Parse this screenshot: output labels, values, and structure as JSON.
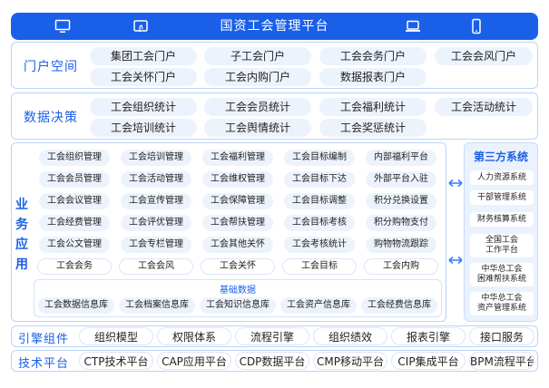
{
  "header": {
    "title": "国资工会管理平台",
    "accent": "#1a5fe8",
    "icons": [
      "desktop-icon",
      "tablet-touch-icon",
      "laptop-icon",
      "mobile-icon"
    ]
  },
  "portal": {
    "label": "门户空间",
    "items": [
      "集团工会门户",
      "子工会门户",
      "工会会务门户",
      "工会会风门户",
      "工会关怀门户",
      "工会内购门户",
      "数据报表门户"
    ]
  },
  "decision": {
    "label": "数据决策",
    "items": [
      "工会组织统计",
      "工会会员统计",
      "工会福利统计",
      "工会活动统计",
      "工会培训统计",
      "工会舆情统计",
      "工会奖惩统计"
    ]
  },
  "business": {
    "label_chars": [
      "业",
      "务",
      "应",
      "用"
    ],
    "grid": [
      [
        "工会组织管理",
        "工会培训管理",
        "工会福利管理",
        "工会目标编制",
        "内部福利平台"
      ],
      [
        "工会会员管理",
        "工会活动管理",
        "工会维权管理",
        "工会目标下达",
        "外部平台入驻"
      ],
      [
        "工会会议管理",
        "工会宣传管理",
        "工会保障管理",
        "工会目标调整",
        "积分兑换设置"
      ],
      [
        "工会经费管理",
        "工会评优管理",
        "工会帮扶管理",
        "工会目标考核",
        "积分购物支付"
      ],
      [
        "工会公文管理",
        "工会专栏管理",
        "工会其他关怀",
        "工会考核统计",
        "购物物流跟踪"
      ]
    ],
    "groups": [
      "工会会务",
      "工会会风",
      "工会关怀",
      "工会目标",
      "工会内购"
    ],
    "base_title": "基础数据",
    "base_items": [
      "工会数据信息库",
      "工会档案信息库",
      "工会知识信息库",
      "工会资产信息库",
      "工会经费信息库"
    ]
  },
  "third_party": {
    "title": "第三方系统",
    "items": [
      "人力资源系统",
      "干部管理系统",
      "财务核算系统",
      "全国工会\n工作平台",
      "中华总工会\n困难帮扶系统",
      "中华总工会\n资产管理系统"
    ]
  },
  "engine": {
    "label": "引擎组件",
    "items": [
      "组织模型",
      "权限体系",
      "流程引擎",
      "组织绩效",
      "报表引擎",
      "接口服务"
    ]
  },
  "tech": {
    "label": "技术平台",
    "items": [
      "CTP技术平台",
      "CAP应用平台",
      "CDP数据平台",
      "CMP移动平台",
      "CIP集成平台",
      "BPM流程平台"
    ]
  }
}
